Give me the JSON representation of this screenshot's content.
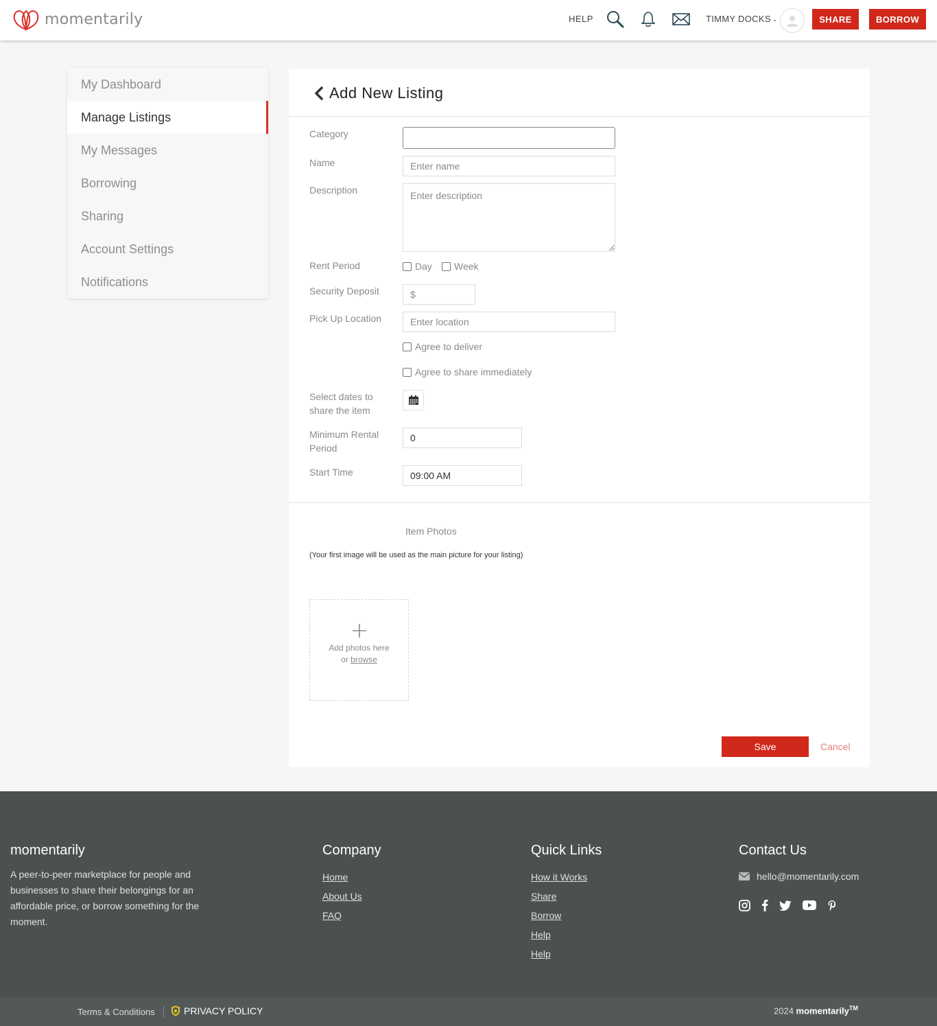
{
  "header": {
    "logo_text": "momentarily",
    "help_label": "HELP",
    "user_name": "TIMMY DOCKS",
    "share_label": "SHARE",
    "borrow_label": "BORROW",
    "icons": [
      "search-icon",
      "bell-icon",
      "mail-icon",
      "chevron-down-icon",
      "user-avatar-icon"
    ]
  },
  "sidebar": {
    "items": [
      {
        "label": "My Dashboard"
      },
      {
        "label": "Manage Listings",
        "active": true
      },
      {
        "label": "My Messages"
      },
      {
        "label": "Borrowing"
      },
      {
        "label": "Sharing"
      },
      {
        "label": "Account Settings"
      },
      {
        "label": "Notifications"
      }
    ]
  },
  "form": {
    "title": "Add New Listing",
    "category_label": "Category",
    "category_value": "",
    "name_label": "Name",
    "name_placeholder": "Enter name",
    "description_label": "Description",
    "description_placeholder": "Enter description",
    "rent_period_label": "Rent Period",
    "rent_day_label": "Day",
    "rent_week_label": "Week",
    "deposit_label": "Security Deposit",
    "deposit_placeholder": "$",
    "pickup_label": "Pick Up Location",
    "pickup_placeholder": "Enter location",
    "agree_deliver_label": "Agree to deliver",
    "agree_share_label": "Agree to share immediately",
    "dates_label_line1": "Select dates to",
    "dates_label_line2": "share the item",
    "min_rental_label_line1": "Minimum Rental",
    "min_rental_label_line2": "Period",
    "min_rental_value": "0",
    "start_time_label": "Start Time",
    "start_time_value": "09:00 AM",
    "photos_title": "Item Photos",
    "photos_note": "(Your first image will be used as the main picture for your listing)",
    "dropzone_text": "Add photos here",
    "dropzone_or": "or",
    "dropzone_link": "browse",
    "save_label": "Save",
    "cancel_label": "Cancel"
  },
  "footer": {
    "brand": "momentarily",
    "description": "A peer-to-peer marketplace for people and businesses to share their belongings for an affordable price, or borrow something for the moment.",
    "company_title": "Company",
    "company_links": [
      "Home",
      "About Us",
      "FAQ"
    ],
    "quick_title": "Quick Links",
    "quick_links": [
      "How it Works",
      "Share",
      "Borrow",
      "Help",
      "Help"
    ],
    "contact_title": "Contact Us",
    "email": "hello@momentarily.com",
    "socials": [
      "instagram-icon",
      "facebook-icon",
      "twitter-icon",
      "youtube-icon",
      "pinterest-icon"
    ],
    "terms_label": "Terms & Conditions",
    "privacy_label": "PRIVACY POLICY",
    "copyright_year": "2024",
    "copyright_brand": "momentarily",
    "copyright_tm": "TM"
  },
  "colors": {
    "accent": "#d0281b",
    "footer_bg": "#4b5150",
    "active_marker": "#d9312a"
  }
}
